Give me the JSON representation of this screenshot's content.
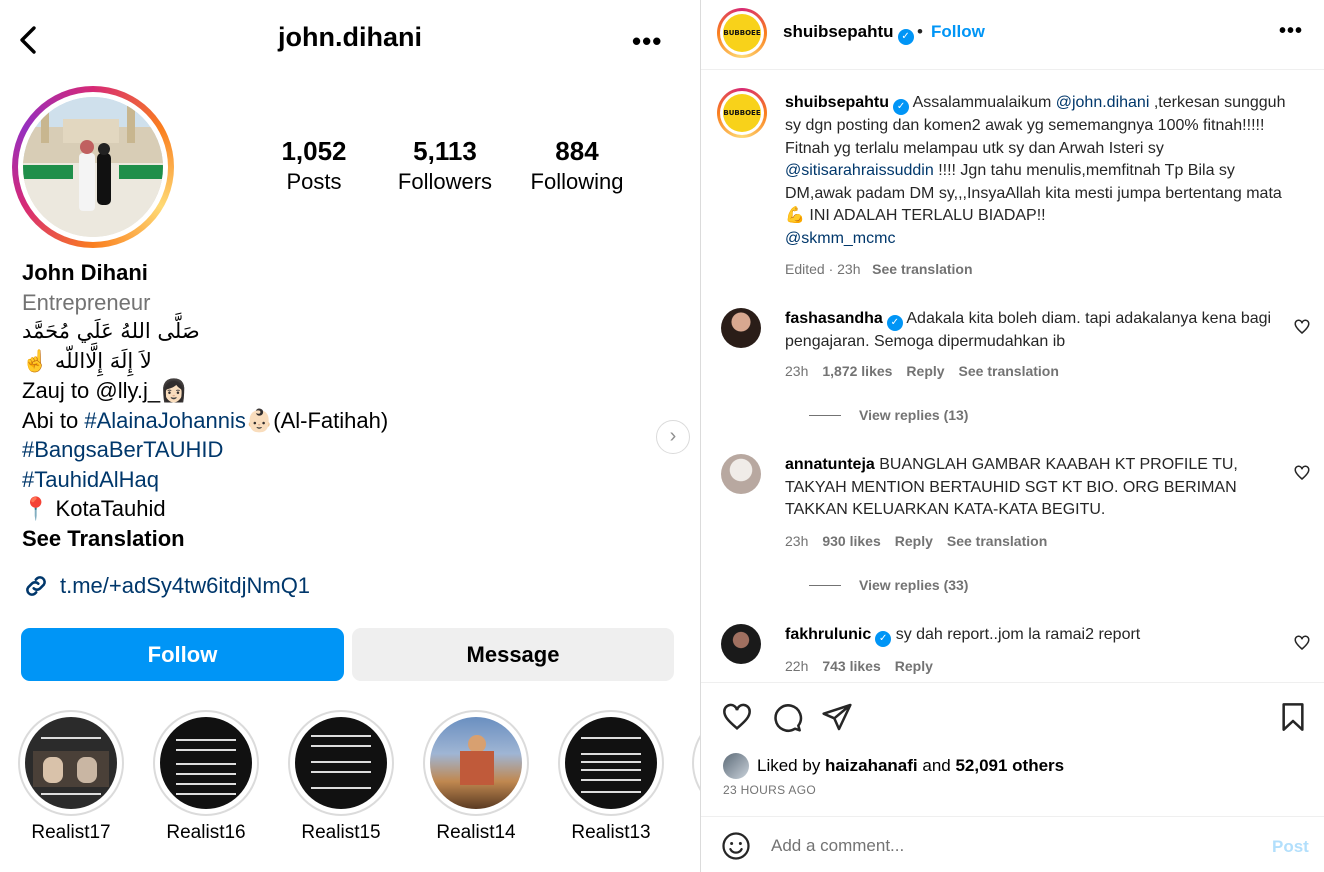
{
  "profile": {
    "username": "john.dihani",
    "stats": {
      "posts_count": "1,052",
      "posts_label": "Posts",
      "followers_count": "5,113",
      "followers_label": "Followers",
      "following_count": "884",
      "following_label": "Following"
    },
    "name": "John Dihani",
    "category": "Entrepreneur",
    "bio": {
      "arabic_line1": "صَلَّى اللهُ عَلَي مُحَمَّد",
      "arabic_line2": "لاَ إِلَهَ إِلَّااللّه ☝️",
      "zauj_prefix": "Zauj to @lly.j_",
      "zauj_emoji": "👩🏻",
      "abi_prefix": "Abi to ",
      "abi_hashtag": "#AlainaJohannis",
      "abi_emoji": "👶🏻",
      "abi_suffix": "(Al-Fatihah)",
      "hashtag1": "#BangsaBerTAUHID",
      "hashtag2": "#TauhidAlHaq",
      "location_pin": "📍",
      "location": "KotaTauhid",
      "see_translation": "See Translation"
    },
    "link": "t.me/+adSy4tw6itdjNmQ1",
    "follow_label": "Follow",
    "message_label": "Message",
    "highlights": [
      {
        "label": "Realist17"
      },
      {
        "label": "Realist16"
      },
      {
        "label": "Realist15"
      },
      {
        "label": "Realist14"
      },
      {
        "label": "Realist13"
      }
    ]
  },
  "post": {
    "author": "shuibsepahtu",
    "logo_text": "BUBBOEE",
    "separator": "•",
    "follow_label": "Follow",
    "caption": {
      "part1": "Assalammualaikum ",
      "mention1": "@john.dihani",
      "part2": " ,terkesan sungguh sy dgn posting dan komen2 awak yg sememangnya 100% fitnah!!!!! Fitnah yg terlalu melampau utk sy dan Arwah Isteri sy ",
      "mention2": "@sitisarahraissuddin",
      "part3": " !!!! Jgn tahu menulis,memfitnah Tp Bila sy DM,awak padam DM sy,,,InsyaAllah kita mesti jumpa bertentang mata 💪 INI ADALAH TERLALU BIADAP!!",
      "mention3": "@skmm_mcmc",
      "meta_time": "Edited · 23h",
      "meta_translate": "See translation"
    },
    "comments": [
      {
        "username": "fashasandha",
        "text": "Adakala kita boleh diam. tapi adakalanya kena bagi pengajaran. Semoga dipermudahkan ib",
        "time": "23h",
        "likes": "1,872 likes",
        "reply": "Reply",
        "translate": "See translation",
        "view_replies": "View replies (13)"
      },
      {
        "username": "annatunteja",
        "text": "BUANGLAH GAMBAR KAABAH KT PROFILE TU, TAKYAH MENTION BERTAUHID SGT KT BIO. ORG BERIMAN TAKKAN KELUARKAN KATA-KATA BEGITU.",
        "time": "23h",
        "likes": "930 likes",
        "reply": "Reply",
        "translate": "See translation",
        "view_replies": "View replies (33)"
      },
      {
        "username": "fakhrulunic",
        "text": "sy dah report..jom la ramai2 report",
        "time": "22h",
        "likes": "743 likes",
        "reply": "Reply"
      }
    ],
    "liked_by_prefix": "Liked by ",
    "liked_by_user": "haizahanafi",
    "liked_by_and": " and ",
    "liked_by_others": "52,091 others",
    "time_ago": "23 HOURS AGO",
    "add_comment_placeholder": "Add a comment...",
    "post_label": "Post"
  },
  "colors": {
    "accent_blue": "#0095f6",
    "link_blue": "#00376b",
    "muted_gray": "#737373",
    "post_disabled": "#b2dffc"
  }
}
